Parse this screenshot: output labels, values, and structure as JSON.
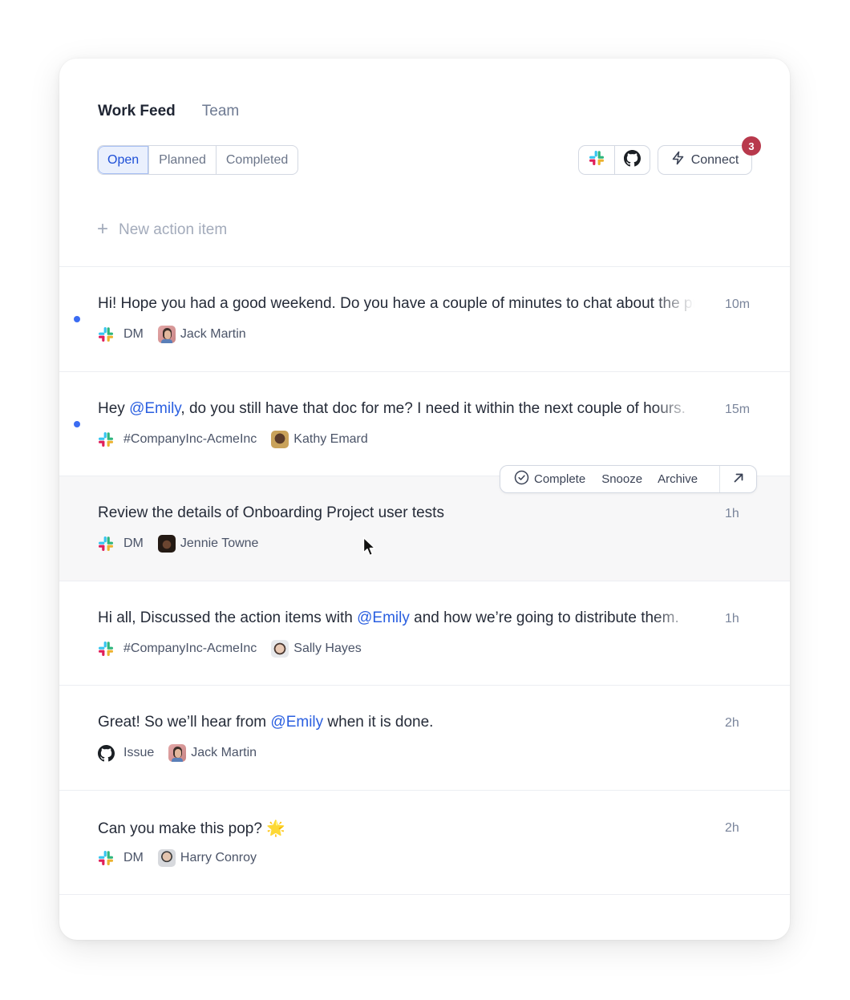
{
  "tabs": [
    {
      "label": "Work Feed",
      "active": true
    },
    {
      "label": "Team",
      "active": false
    }
  ],
  "filters": [
    {
      "label": "Open",
      "active": true
    },
    {
      "label": "Planned",
      "active": false
    },
    {
      "label": "Completed",
      "active": false
    }
  ],
  "integrations": [
    {
      "name": "Slack",
      "icon": "slack-icon"
    },
    {
      "name": "GitHub",
      "icon": "github-icon"
    }
  ],
  "connect": {
    "label": "Connect",
    "icon": "lightning-icon",
    "badge_count": "3"
  },
  "new_item": {
    "placeholder": "New action item",
    "icon": "plus-icon"
  },
  "row_actions": {
    "complete": "Complete",
    "snooze": "Snooze",
    "archive": "Archive",
    "open_icon": "arrow-up-right-icon"
  },
  "colors": {
    "accent": "#1d4fd7",
    "mention": "#2a5fe0",
    "unread_dot": "#3b6cf2",
    "badge": "#b8394c",
    "hover_row": "#f7f7f8"
  },
  "feed": [
    {
      "unread": true,
      "parts": [
        {
          "text": "Hi! Hope you had a good weekend. Do you have a couple of minutes to chat about the project?"
        }
      ],
      "time": "10m",
      "source": "slack",
      "channel": "DM",
      "person": "Jack Martin"
    },
    {
      "unread": true,
      "parts": [
        {
          "text": "Hey "
        },
        {
          "text": "@Emily",
          "mention": true
        },
        {
          "text": ", do you still have that doc for me? I need it within the next couple of hours."
        }
      ],
      "time": "15m",
      "source": "slack",
      "channel": "#CompanyInc-AcmeInc",
      "person": "Kathy Emard"
    },
    {
      "unread": false,
      "hover": true,
      "parts": [
        {
          "text": "Review the details of Onboarding Project user tests"
        }
      ],
      "time": "1h",
      "source": "slack",
      "channel": "DM",
      "person": "Jennie Towne"
    },
    {
      "unread": false,
      "parts": [
        {
          "text": "Hi all, Discussed the action items with "
        },
        {
          "text": "@Emily",
          "mention": true
        },
        {
          "text": " and how we’re going to distribute them."
        }
      ],
      "time": "1h",
      "source": "slack",
      "channel": "#CompanyInc-AcmeInc",
      "person": "Sally Hayes"
    },
    {
      "unread": false,
      "parts": [
        {
          "text": "Great! So we’ll hear from "
        },
        {
          "text": "@Emily",
          "mention": true
        },
        {
          "text": " when it is done."
        }
      ],
      "time": "2h",
      "source": "github",
      "channel": "Issue",
      "person": "Jack Martin"
    },
    {
      "unread": false,
      "parts": [
        {
          "text": "Can you make this pop? 🌟"
        }
      ],
      "time": "2h",
      "source": "slack",
      "channel": "DM",
      "person": "Harry Conroy"
    }
  ]
}
